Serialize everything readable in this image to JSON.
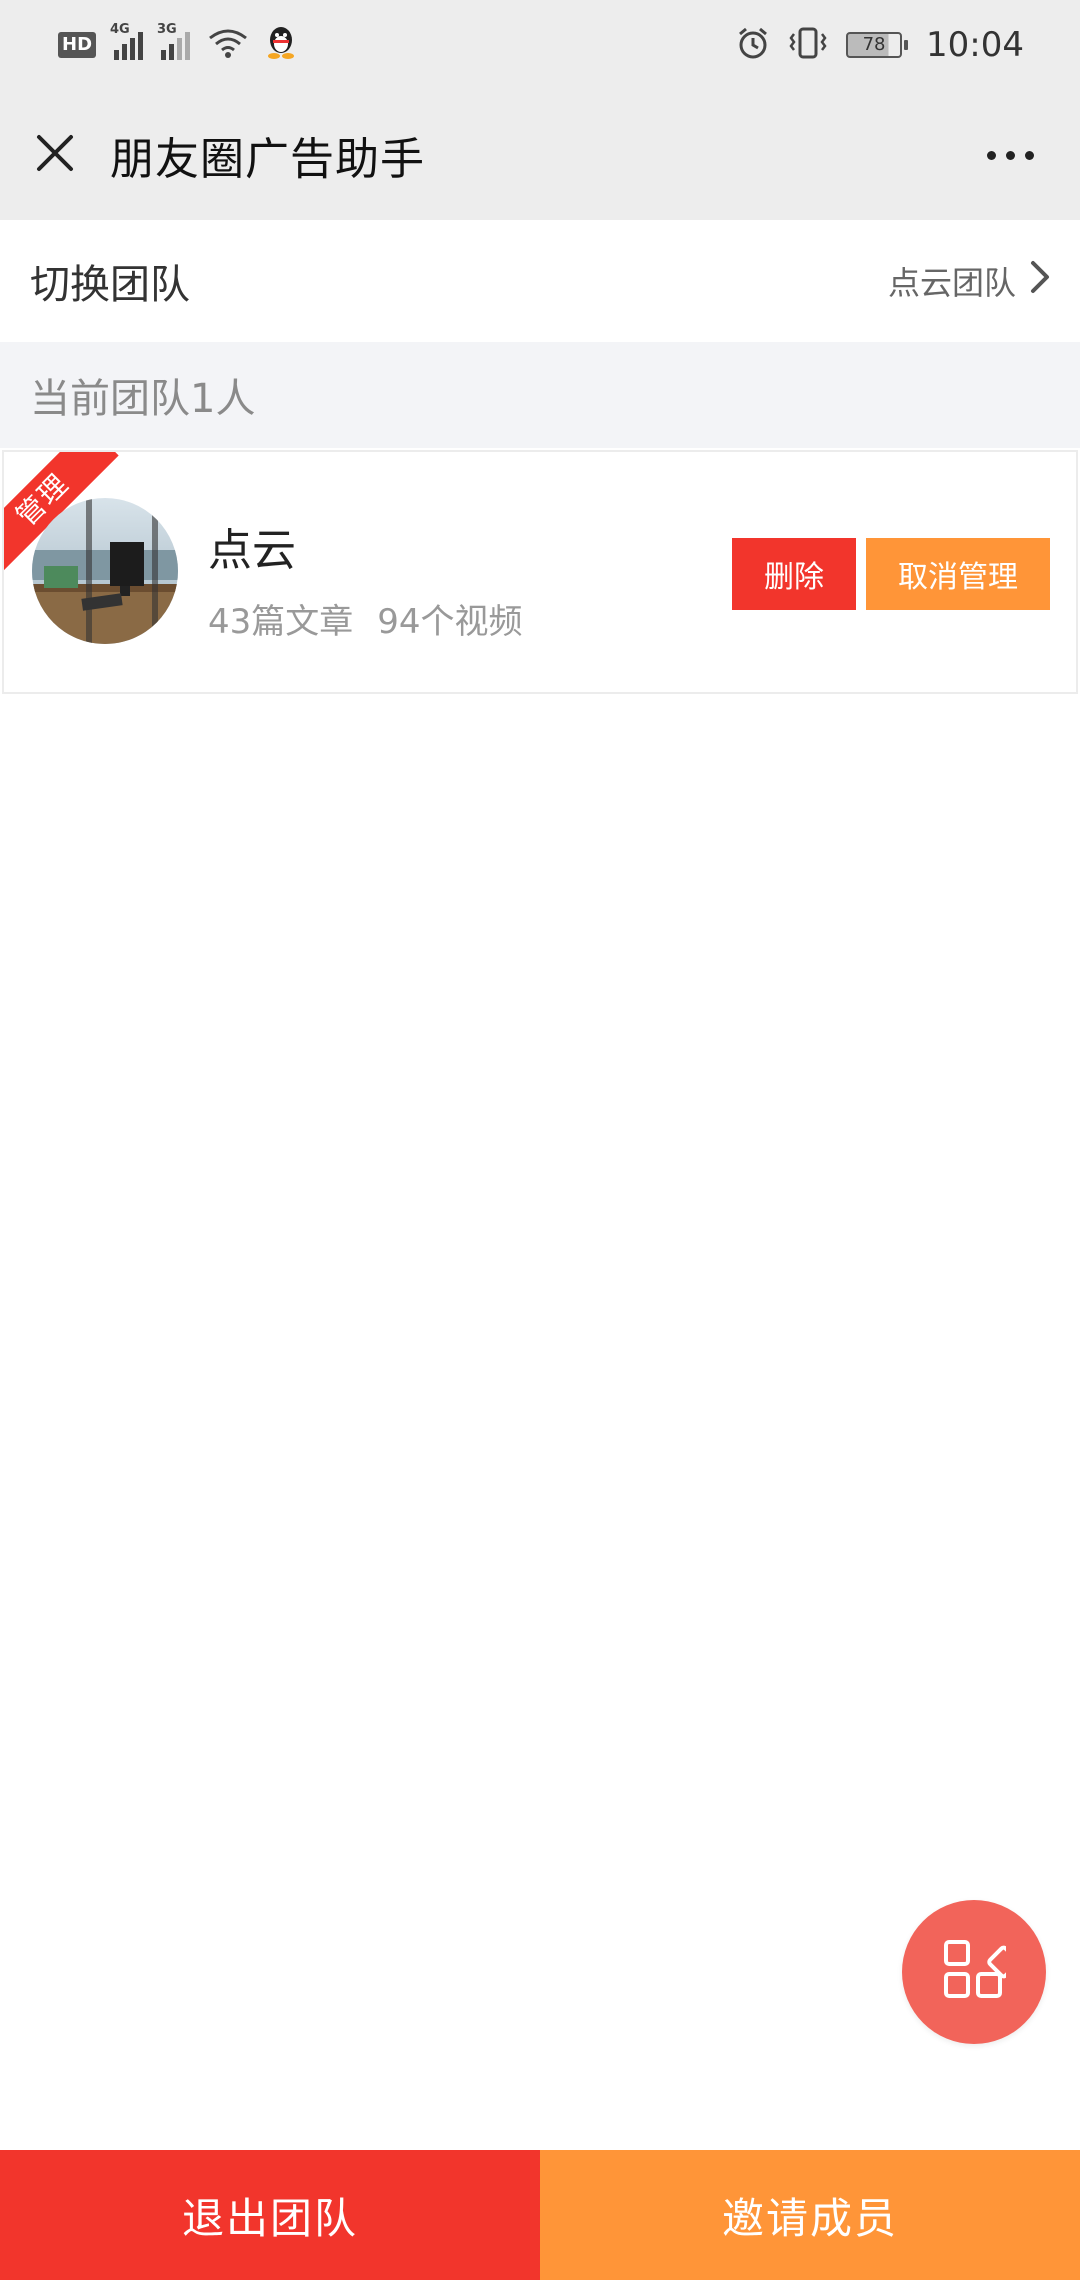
{
  "status_bar": {
    "hd_label": "HD",
    "net1": "4G",
    "net2": "3G",
    "battery": "78",
    "time": "10:04"
  },
  "header": {
    "title": "朋友圈广告助手",
    "close_icon": "close-icon",
    "more_icon": "more-icon"
  },
  "switch_team": {
    "label": "切换团队",
    "value": "点云团队"
  },
  "team": {
    "section_title": "当前团队1人",
    "members": [
      {
        "role_badge": "管理",
        "name": "点云",
        "articles": "43篇文章",
        "videos": "94个视频",
        "delete_label": "删除",
        "cancel_admin_label": "取消管理"
      }
    ]
  },
  "bottom": {
    "exit_label": "退出团队",
    "invite_label": "邀请成员"
  },
  "colors": {
    "red": "#f2352c",
    "orange": "#ff9538",
    "fab": "#f2645a",
    "header_bg": "#ededed",
    "section_bg": "#f3f4f7"
  }
}
